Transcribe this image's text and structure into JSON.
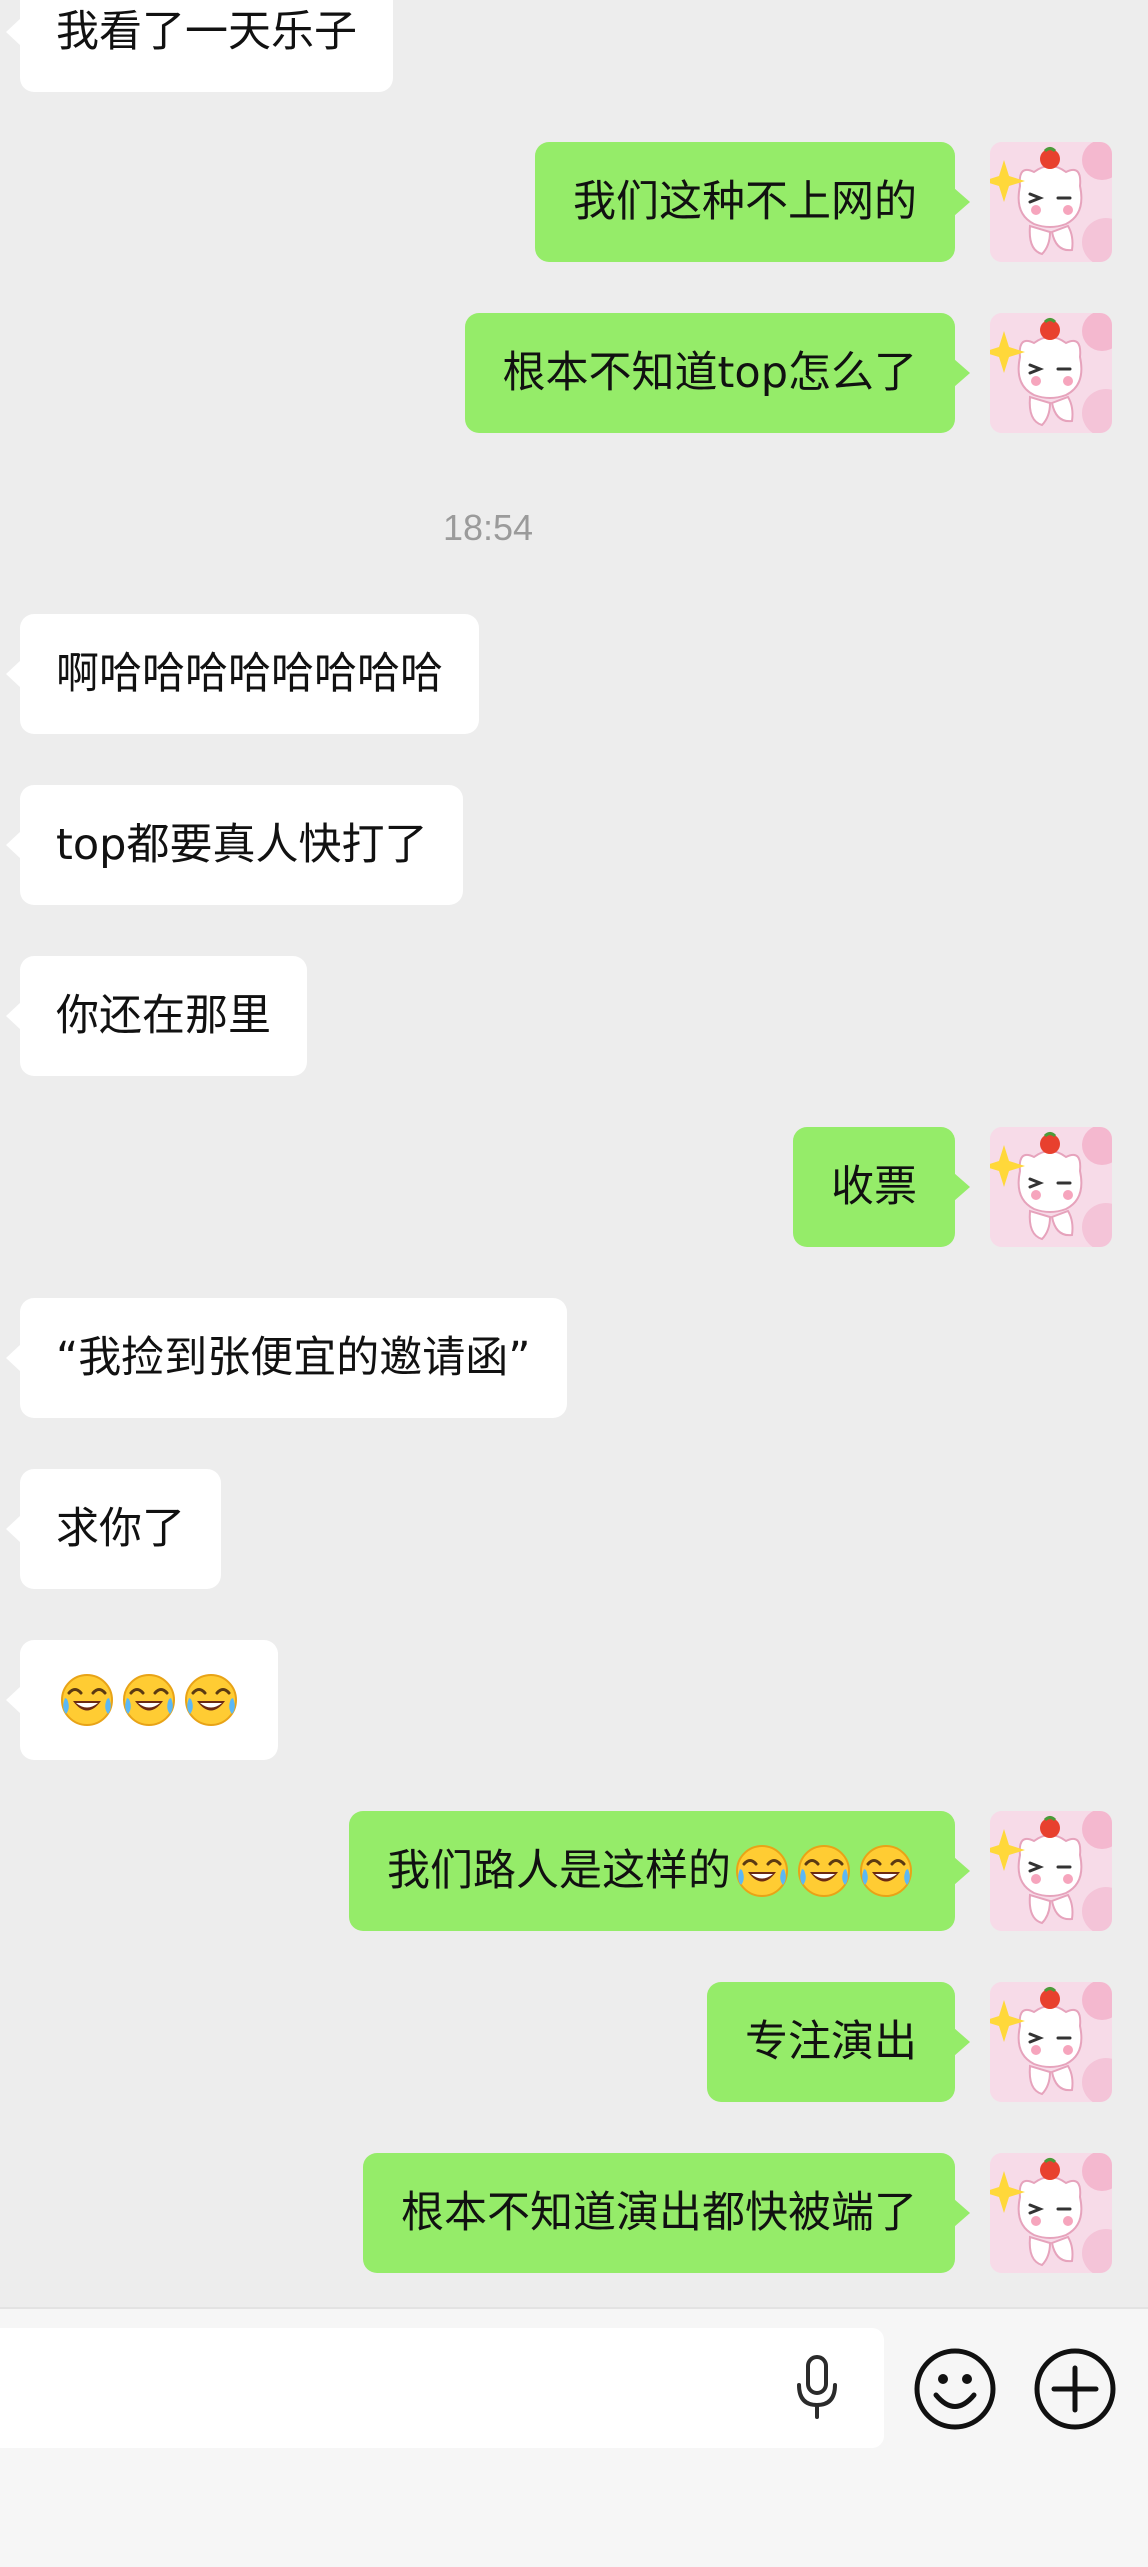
{
  "messages": {
    "m1": "我看了一天乐子",
    "m2": "我们这种不上网的",
    "m3": "根本不知道top怎么了",
    "m4": "啊哈哈哈哈哈哈哈哈",
    "m5": "top都要真人快打了",
    "m6": "你还在那里",
    "m7": "收票",
    "m8": "“我捡到张便宜的邀请函”",
    "m9": "求你了",
    "m10_emojis": "😂😂😂",
    "m11": "我们路人是这样的",
    "m11_emojis": "😂😂😂",
    "m12": "专注演出",
    "m13": "根本不知道演出都快被端了"
  },
  "timestamp": "18:54",
  "icons": {
    "avatar": "cartoon-cat-avatar",
    "voice": "microphone-icon",
    "emoji": "smiley-icon",
    "more": "plus-icon"
  },
  "colors": {
    "background": "#ededed",
    "sent_bubble": "#95ec69",
    "received_bubble": "#ffffff"
  }
}
